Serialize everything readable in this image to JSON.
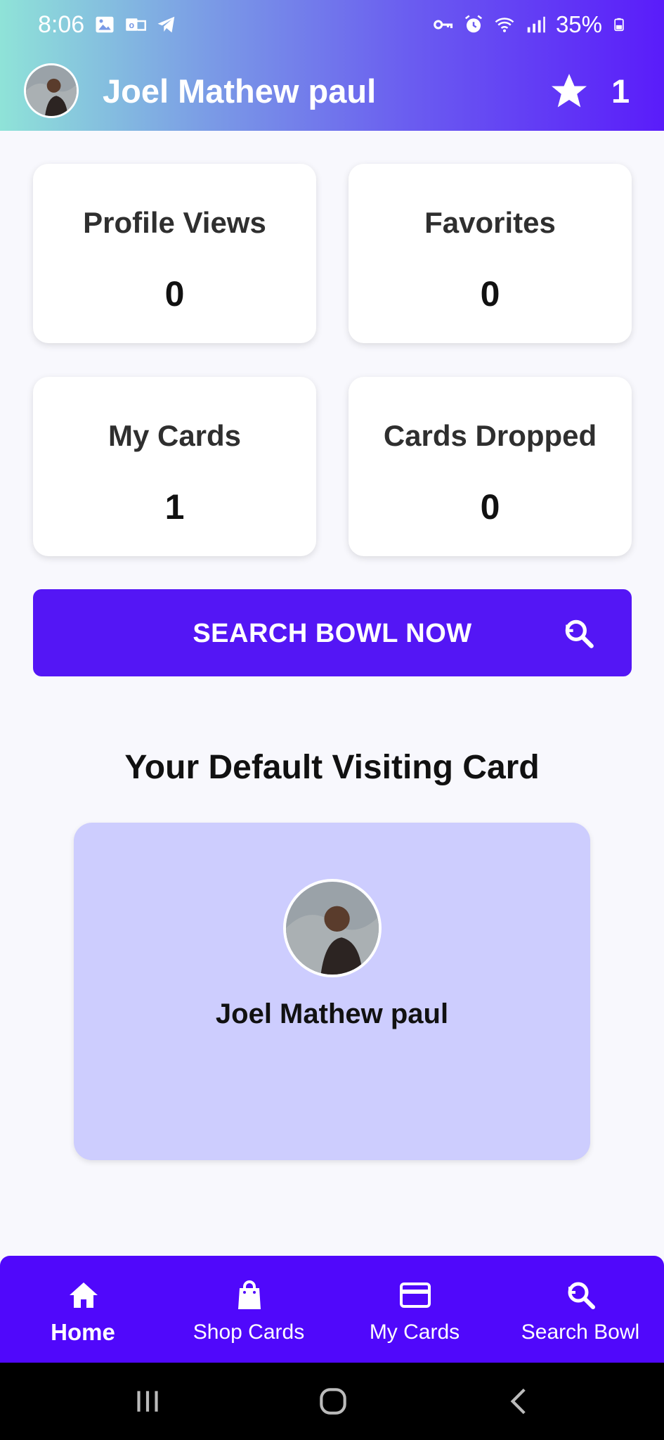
{
  "status_bar": {
    "time": "8:06",
    "battery": "35%"
  },
  "header": {
    "title": "Joel Mathew paul",
    "star_count": "1"
  },
  "stats": [
    {
      "label": "Profile Views",
      "value": "0"
    },
    {
      "label": "Favorites",
      "value": "0"
    },
    {
      "label": "My Cards",
      "value": "1"
    },
    {
      "label": "Cards Dropped",
      "value": "0"
    }
  ],
  "search_button": {
    "label": "SEARCH BOWL NOW"
  },
  "default_card": {
    "section_title": "Your Default Visiting Card",
    "name": "Joel Mathew paul"
  },
  "bottom_nav": {
    "items": [
      {
        "label": "Home",
        "icon": "home-icon",
        "active": true
      },
      {
        "label": "Shop Cards",
        "icon": "shopping-bag-icon",
        "active": false
      },
      {
        "label": "My Cards",
        "icon": "credit-card-icon",
        "active": false
      },
      {
        "label": "Search Bowl",
        "icon": "search-icon",
        "active": false
      }
    ]
  },
  "colors": {
    "primary": "#5008fb",
    "card_background": "#cdcdfe",
    "page_background": "#f8f8fd"
  }
}
